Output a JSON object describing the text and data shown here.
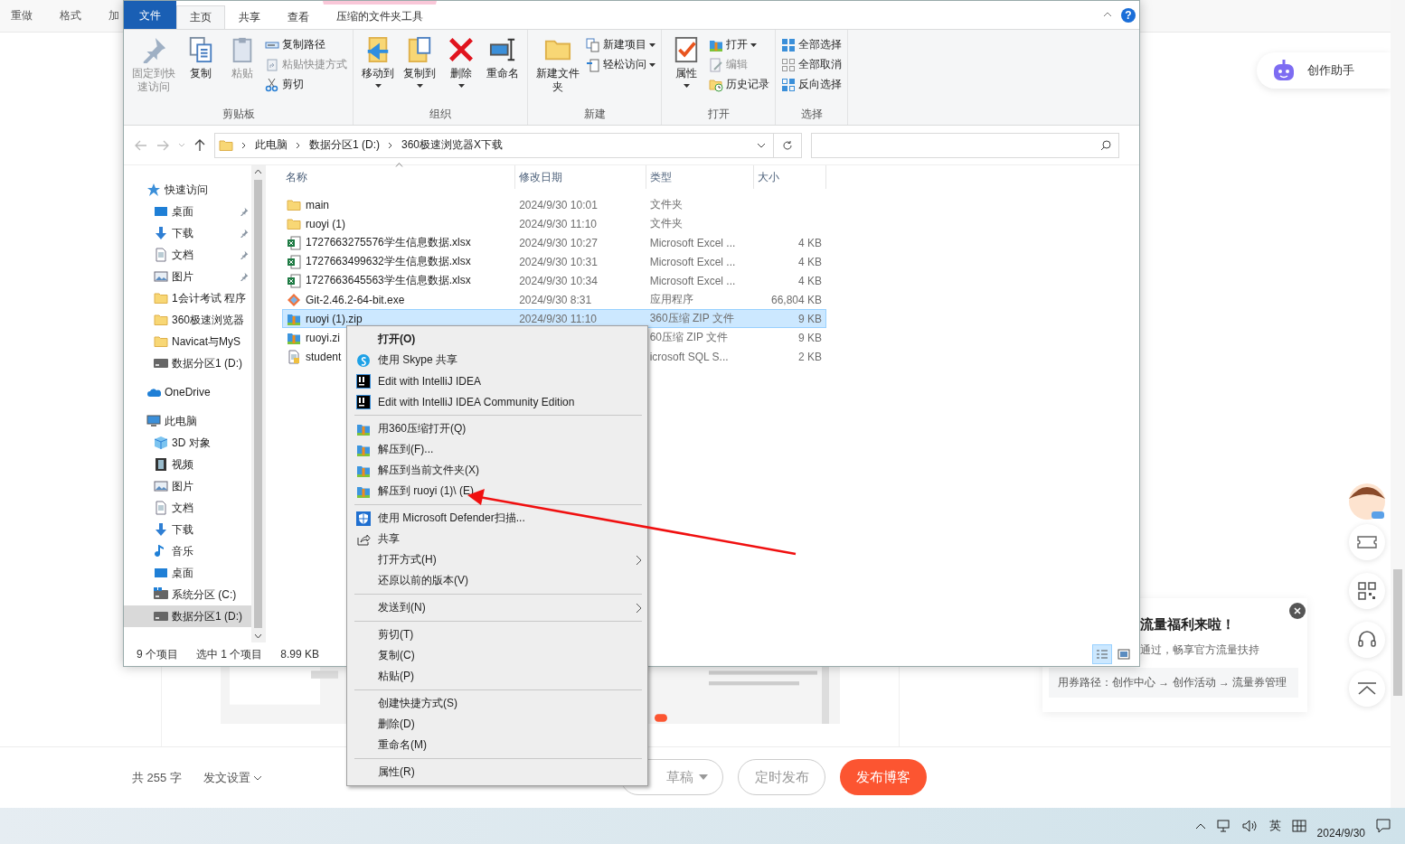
{
  "editor_toolbar": [
    {
      "label": "重做"
    },
    {
      "label": "格式"
    },
    {
      "label": "加"
    }
  ],
  "assistant": {
    "label": "创作助手"
  },
  "explorer": {
    "tabs": [
      {
        "label": "文件",
        "kind": "file",
        "selected": false
      },
      {
        "label": "主页",
        "kind": "tab",
        "selected": true
      },
      {
        "label": "共享",
        "kind": "tab",
        "selected": false
      },
      {
        "label": "查看",
        "kind": "tab",
        "selected": false
      },
      {
        "label": "压缩的文件夹工具",
        "kind": "context",
        "selected": false
      }
    ],
    "help_glyph": "?",
    "ribbon_groups": [
      {
        "label": "剪贴板",
        "large": [
          {
            "label": "固定到快速访问",
            "kind": "pin",
            "disabled": true,
            "dropdown": false
          },
          {
            "label": "复制",
            "kind": "copy",
            "disabled": false,
            "dropdown": false
          },
          {
            "label": "粘贴",
            "kind": "paste",
            "disabled": true,
            "dropdown": false
          }
        ],
        "small": [
          {
            "label": "复制路径",
            "kind": "path",
            "disabled": false,
            "dropdown": false
          },
          {
            "label": "粘贴快捷方式",
            "kind": "shortcut",
            "disabled": true,
            "dropdown": false
          },
          {
            "label": "剪切",
            "kind": "cut",
            "disabled": false,
            "dropdown": false
          }
        ]
      },
      {
        "label": "组织",
        "large": [
          {
            "label": "移动到",
            "kind": "move",
            "disabled": false,
            "dropdown": true
          },
          {
            "label": "复制到",
            "kind": "copyto",
            "disabled": false,
            "dropdown": true
          },
          {
            "label": "删除",
            "kind": "delete",
            "disabled": false,
            "dropdown": true
          },
          {
            "label": "重命名",
            "kind": "rename",
            "disabled": false,
            "dropdown": false
          }
        ]
      },
      {
        "label": "新建",
        "large": [
          {
            "label": "新建文件夹",
            "kind": "newfolder",
            "disabled": false,
            "dropdown": false
          }
        ],
        "small": [
          {
            "label": "新建项目",
            "kind": "newitem",
            "disabled": false,
            "dropdown": true
          },
          {
            "label": "轻松访问",
            "kind": "easy",
            "disabled": false,
            "dropdown": true
          }
        ]
      },
      {
        "label": "打开",
        "large": [
          {
            "label": "属性",
            "kind": "props",
            "disabled": false,
            "dropdown": true
          }
        ],
        "small": [
          {
            "label": "打开",
            "kind": "open",
            "disabled": false,
            "dropdown": true
          },
          {
            "label": "编辑",
            "kind": "edit",
            "disabled": true,
            "dropdown": false
          },
          {
            "label": "历史记录",
            "kind": "history",
            "disabled": false,
            "dropdown": false
          }
        ]
      },
      {
        "label": "选择",
        "small": [
          {
            "label": "全部选择",
            "kind": "selall",
            "disabled": false,
            "dropdown": false
          },
          {
            "label": "全部取消",
            "kind": "selnone",
            "disabled": false,
            "dropdown": false
          },
          {
            "label": "反向选择",
            "kind": "invert",
            "disabled": false,
            "dropdown": false
          }
        ]
      }
    ],
    "address": {
      "crumbs": [
        "此电脑",
        "数据分区1 (D:)",
        "360极速浏览器X下载"
      ]
    },
    "nav": [
      {
        "label": "快速访问",
        "kind": "star",
        "selected": false,
        "pinned": false,
        "children": [
          {
            "label": "桌面",
            "kind": "desktop",
            "selected": false,
            "pinned": true
          },
          {
            "label": "下载",
            "kind": "download",
            "selected": false,
            "pinned": true
          },
          {
            "label": "文档",
            "kind": "doc",
            "selected": false,
            "pinned": true
          },
          {
            "label": "图片",
            "kind": "picture",
            "selected": false,
            "pinned": true
          },
          {
            "label": "1会计考试 程序",
            "kind": "folder",
            "selected": false,
            "pinned": false
          },
          {
            "label": "360极速浏览器",
            "kind": "folder",
            "selected": false,
            "pinned": false
          },
          {
            "label": "Navicat与MyS",
            "kind": "folder",
            "selected": false,
            "pinned": false
          },
          {
            "label": "数据分区1 (D:)",
            "kind": "drive",
            "selected": false,
            "pinned": false
          }
        ]
      },
      {
        "label": "OneDrive",
        "kind": "cloud",
        "selected": false,
        "pinned": false
      },
      {
        "label": "此电脑",
        "kind": "pc",
        "selected": false,
        "pinned": false,
        "children": [
          {
            "label": "3D 对象",
            "kind": "cube",
            "selected": false,
            "pinned": false
          },
          {
            "label": "视频",
            "kind": "film",
            "selected": false,
            "pinned": false
          },
          {
            "label": "图片",
            "kind": "picture",
            "selected": false,
            "pinned": false
          },
          {
            "label": "文档",
            "kind": "doc",
            "selected": false,
            "pinned": false
          },
          {
            "label": "下载",
            "kind": "download",
            "selected": false,
            "pinned": false
          },
          {
            "label": "音乐",
            "kind": "music",
            "selected": false,
            "pinned": false
          },
          {
            "label": "桌面",
            "kind": "desktop",
            "selected": false,
            "pinned": false
          },
          {
            "label": "系统分区 (C:)",
            "kind": "sysdrive",
            "selected": false,
            "pinned": false
          },
          {
            "label": "数据分区1 (D:)",
            "kind": "drive",
            "selected": true,
            "pinned": false
          }
        ]
      }
    ],
    "columns": [
      {
        "label": "名称",
        "sorted": true
      },
      {
        "label": "修改日期",
        "sorted": false
      },
      {
        "label": "类型",
        "sorted": false
      },
      {
        "label": "大小",
        "sorted": false
      }
    ],
    "rows": [
      {
        "name": "main",
        "kind": "folder",
        "date": "2024/9/30 10:01",
        "type": "文件夹",
        "selected": false
      },
      {
        "name": "ruoyi (1)",
        "kind": "folder",
        "date": "2024/9/30 11:10",
        "type": "文件夹",
        "selected": false
      },
      {
        "name": "1727663275576学生信息数据.xlsx",
        "kind": "excel",
        "date": "2024/9/30 10:27",
        "type": "Microsoft Excel ...",
        "size": "4 KB",
        "selected": false
      },
      {
        "name": "1727663499632学生信息数据.xlsx",
        "kind": "excel",
        "date": "2024/9/30 10:31",
        "type": "Microsoft Excel ...",
        "size": "4 KB",
        "selected": false
      },
      {
        "name": "1727663645563学生信息数据.xlsx",
        "kind": "excel",
        "date": "2024/9/30 10:34",
        "type": "Microsoft Excel ...",
        "size": "4 KB",
        "selected": false
      },
      {
        "name": "Git-2.46.2-64-bit.exe",
        "kind": "exe",
        "date": "2024/9/30 8:31",
        "type": "应用程序",
        "size": "66,804 KB",
        "selected": false
      },
      {
        "name": "ruoyi (1).zip",
        "kind": "zip",
        "date": "2024/9/30 11:10",
        "type": "360压缩 ZIP 文件",
        "size": "9 KB",
        "selected": true
      },
      {
        "name": "ruoyi.zi",
        "kind": "zip",
        "type": "60压缩 ZIP 文件",
        "size": "9 KB",
        "selected": false
      },
      {
        "name": "student",
        "kind": "sql",
        "type": "icrosoft SQL S...",
        "size": "2 KB",
        "selected": false
      }
    ],
    "status": [
      "9 个项目",
      "选中 1 个项目",
      "8.99 KB"
    ],
    "views": [
      {
        "kind": "details",
        "selected": true
      },
      {
        "kind": "tiles",
        "selected": false
      }
    ]
  },
  "context_menu": [
    {
      "kind": "item",
      "label": "打开(O)",
      "bold": true,
      "submenu": false
    },
    {
      "kind": "skype",
      "label": "使用 Skype 共享",
      "bold": false,
      "submenu": false
    },
    {
      "kind": "intellij",
      "label": "Edit with IntelliJ IDEA",
      "bold": false,
      "submenu": false
    },
    {
      "kind": "intellij",
      "label": "Edit with IntelliJ IDEA Community Edition",
      "bold": false,
      "submenu": false
    },
    {
      "kind": "separator"
    },
    {
      "kind": "zip",
      "label": "用360压缩打开(Q)",
      "bold": false,
      "submenu": false
    },
    {
      "kind": "zip",
      "label": "解压到(F)...",
      "bold": false,
      "submenu": false
    },
    {
      "kind": "zip",
      "label": "解压到当前文件夹(X)",
      "bold": false,
      "submenu": false
    },
    {
      "kind": "zip",
      "label": "解压到 ruoyi (1)\\ (E)",
      "bold": false,
      "submenu": false
    },
    {
      "kind": "separator"
    },
    {
      "kind": "defender",
      "label": "使用 Microsoft Defender扫描...",
      "bold": false,
      "submenu": false
    },
    {
      "kind": "share",
      "label": "共享",
      "bold": false,
      "submenu": false
    },
    {
      "kind": "item",
      "label": "打开方式(H)",
      "bold": false,
      "submenu": true
    },
    {
      "kind": "item",
      "label": "还原以前的版本(V)",
      "bold": false,
      "submenu": false
    },
    {
      "kind": "separator"
    },
    {
      "kind": "item",
      "label": "发送到(N)",
      "bold": false,
      "submenu": true
    },
    {
      "kind": "separator"
    },
    {
      "kind": "item",
      "label": "剪切(T)",
      "bold": false,
      "submenu": false
    },
    {
      "kind": "item",
      "label": "复制(C)",
      "bold": false,
      "submenu": false
    },
    {
      "kind": "item",
      "label": "粘贴(P)",
      "bold": false,
      "submenu": false
    },
    {
      "kind": "separator"
    },
    {
      "kind": "item",
      "label": "创建快捷方式(S)",
      "bold": false,
      "submenu": false
    },
    {
      "kind": "item",
      "label": "删除(D)",
      "bold": false,
      "submenu": false
    },
    {
      "kind": "item",
      "label": "重命名(M)",
      "bold": false,
      "submenu": false
    },
    {
      "kind": "separator"
    },
    {
      "kind": "item",
      "label": "属性(R)",
      "bold": false,
      "submenu": false
    }
  ],
  "promo": {
    "title": "流量福利来啦！",
    "subtitle": "通过，畅享官方流量扶持",
    "path": "用券路径：创作中心 → 创作活动 → 流量券管理"
  },
  "bottom_bar": {
    "word_count": "共 255 字",
    "settings": "发文设置",
    "buttons": [
      {
        "label": "草稿",
        "kind": "draft"
      },
      {
        "label": "定时发布",
        "kind": "outline"
      },
      {
        "label": "发布博客",
        "kind": "primary"
      }
    ]
  },
  "taskbar": {
    "ime": "英",
    "date": "2024/9/30"
  }
}
